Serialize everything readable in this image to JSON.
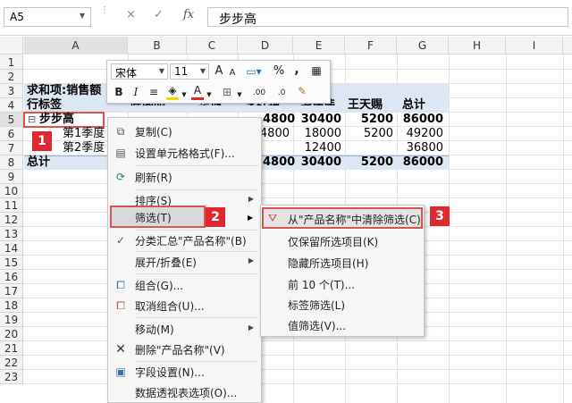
{
  "formula_bar": {
    "name_box": "A5",
    "cancel_icon": "×",
    "enter_icon": "✓",
    "fx_label": "fx",
    "formula": "步步高"
  },
  "columns": [
    "A",
    "B",
    "C",
    "D",
    "E",
    "F",
    "G",
    "H",
    "I"
  ],
  "rows": [
    "1",
    "2",
    "3",
    "4",
    "5",
    "6",
    "7",
    "8",
    "9",
    "10",
    "11",
    "12",
    "13",
    "14",
    "15",
    "16",
    "17",
    "18",
    "19",
    "20",
    "21",
    "22",
    "23"
  ],
  "pivot": {
    "row3_title": "求和项:销售额",
    "row3_total": "总计",
    "row3_name_wang": "王天赐",
    "row4_label": "行标签",
    "header_names": [
      "陈函园",
      "华博",
      "李红艳",
      "毛伟伟"
    ],
    "row5": {
      "label": "步步高",
      "collapse_icon": "⊟",
      "d": "4800",
      "e": "30400",
      "f": "5200",
      "g": "86000"
    },
    "row6": {
      "label": "第1季度",
      "d": "4800",
      "e": "18000",
      "f": "5200",
      "g": "49200"
    },
    "row7": {
      "label": "第2季度",
      "e": "12400",
      "g": "36800"
    },
    "row8": {
      "label": "总计",
      "d": "4800",
      "e": "30400",
      "f": "5200",
      "g": "86000"
    }
  },
  "mini_toolbar": {
    "font_name": "宋体",
    "font_size": "11",
    "grow_font": "A",
    "shrink_font": "A",
    "percent": "%",
    "comma": ",",
    "bold": "B",
    "italic": "I",
    "font_color_letter": "A",
    "inc_decimal": ".00",
    "dec_decimal": ".0"
  },
  "context_menu": {
    "items": [
      {
        "label": "复制(C)",
        "icon": "copy-icon"
      },
      {
        "label": "设置单元格格式(F)...",
        "icon": "format-cells-icon"
      },
      {
        "label": "刷新(R)",
        "icon": "refresh-icon"
      },
      {
        "label": "排序(S)",
        "icon": ""
      },
      {
        "label": "筛选(T)",
        "icon": ""
      },
      {
        "label": "分类汇总\"产品名称\"(B)",
        "icon": "check-icon"
      },
      {
        "label": "展开/折叠(E)",
        "icon": ""
      },
      {
        "label": "组合(G)...",
        "icon": "group-icon"
      },
      {
        "label": "取消组合(U)...",
        "icon": "ungroup-icon"
      },
      {
        "label": "移动(M)",
        "icon": ""
      },
      {
        "label": "删除\"产品名称\"(V)",
        "icon": "delete-icon"
      },
      {
        "label": "字段设置(N)...",
        "icon": "field-settings-icon"
      },
      {
        "label": "数据透视表选项(O)...",
        "icon": ""
      }
    ]
  },
  "submenu": {
    "items": [
      {
        "label": "从\"产品名称\"中清除筛选(C)"
      },
      {
        "label": "仅保留所选项目(K)"
      },
      {
        "label": "隐藏所选项目(H)"
      },
      {
        "label": "前 10 个(T)..."
      },
      {
        "label": "标签筛选(L)"
      },
      {
        "label": "值筛选(V)..."
      }
    ]
  },
  "badges": [
    "1",
    "2",
    "3"
  ],
  "colors": {
    "accent_red": "#e0292f",
    "header_band": "#dde7f3"
  }
}
